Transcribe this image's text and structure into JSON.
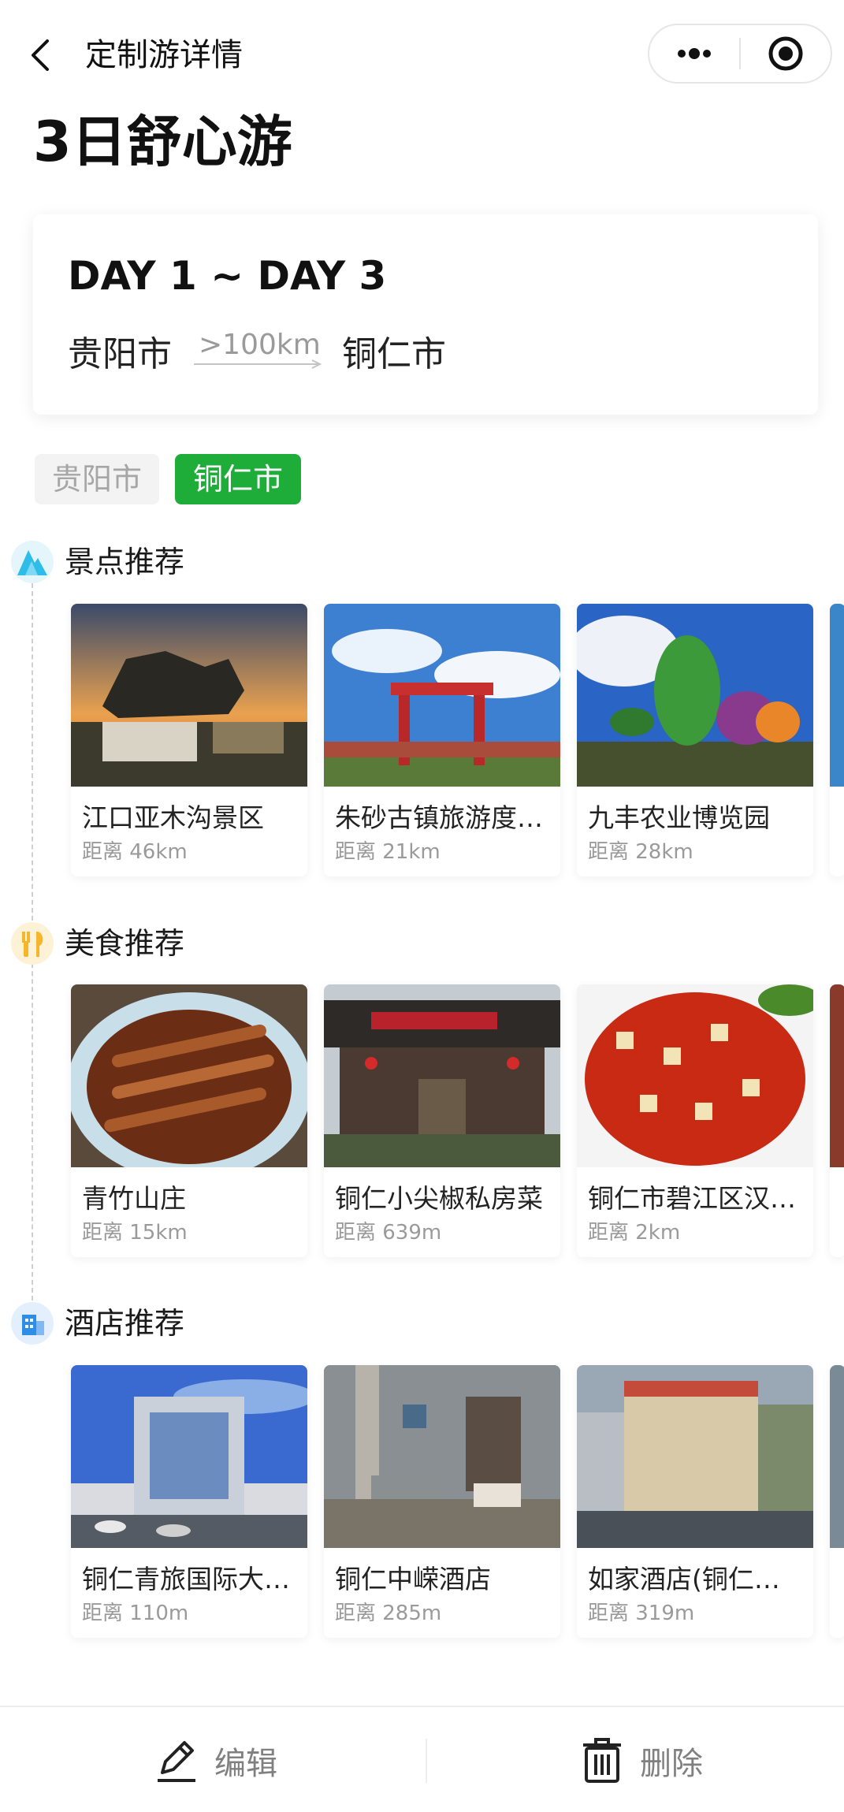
{
  "nav": {
    "title": "定制游详情"
  },
  "page_title": "3日舒心游",
  "route": {
    "day_range": "DAY 1 ~ DAY 3",
    "from": "贵阳市",
    "distance": ">100km",
    "to": "铜仁市"
  },
  "city_tabs": [
    {
      "label": "贵阳市",
      "active": false
    },
    {
      "label": "铜仁市",
      "active": true
    }
  ],
  "sections": {
    "sights": {
      "title": "景点推荐",
      "icon": "mountain-icon",
      "color": "#2dbde8",
      "items": [
        {
          "name": "江口亚木沟景区",
          "distance": "距离 46km"
        },
        {
          "name": "朱砂古镇旅游度…",
          "distance": "距离 21km"
        },
        {
          "name": "九丰农业博览园",
          "distance": "距离 28km"
        }
      ]
    },
    "food": {
      "title": "美食推荐",
      "icon": "fork-knife-icon",
      "color": "#f6b62b",
      "items": [
        {
          "name": "青竹山庄",
          "distance": "距离 15km"
        },
        {
          "name": "铜仁小尖椒私房菜",
          "distance": "距离 639m"
        },
        {
          "name": "铜仁市碧江区汉…",
          "distance": "距离 2km"
        }
      ]
    },
    "hotels": {
      "title": "酒店推荐",
      "icon": "building-icon",
      "color": "#2d8ee8",
      "items": [
        {
          "name": "铜仁青旅国际大…",
          "distance": "距离 110m"
        },
        {
          "name": "铜仁中嵘酒店",
          "distance": "距离 285m"
        },
        {
          "name": "如家酒店(铜仁火…",
          "distance": "距离 319m"
        }
      ]
    }
  },
  "bottom_bar": {
    "edit_label": "编辑",
    "delete_label": "删除"
  },
  "colors": {
    "accent_green": "#1fad3a"
  }
}
